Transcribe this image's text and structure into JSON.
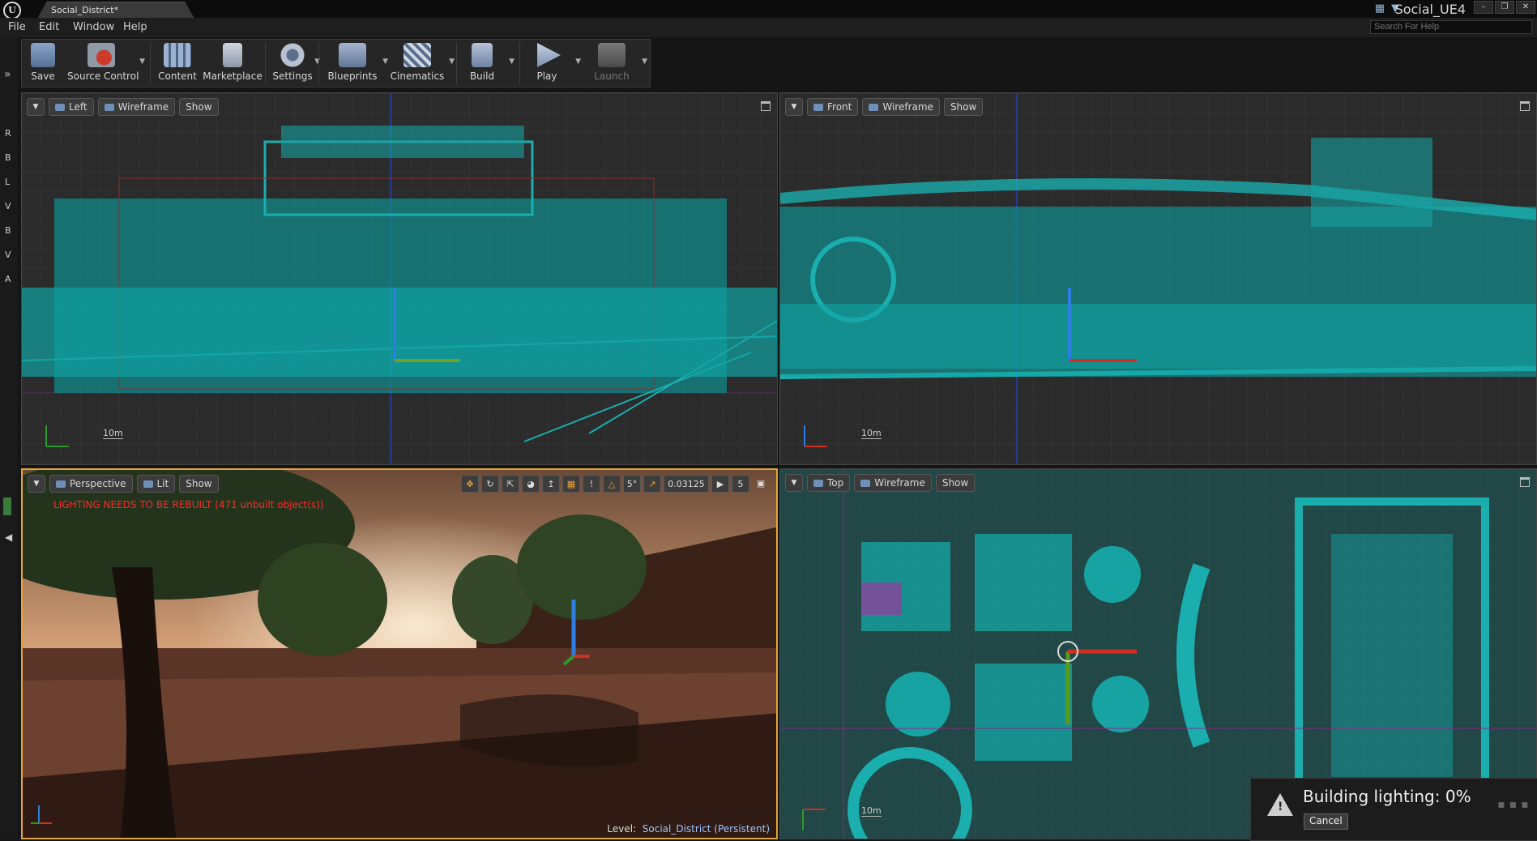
{
  "window": {
    "tab_title": "Social_District*",
    "project_name": "Social_UE4",
    "search_help_placeholder": "Search For Help"
  },
  "menu": {
    "items": [
      "File",
      "Edit",
      "Window",
      "Help"
    ]
  },
  "left_tabs": [
    "R",
    "B",
    "L",
    "V",
    "B",
    "V",
    "A"
  ],
  "toolbar": {
    "buttons": [
      {
        "label": "Save",
        "icon": "floppy-disk-icon"
      },
      {
        "label": "Source Control",
        "icon": "source-control-icon"
      },
      {
        "label": "Content",
        "icon": "content-browser-icon"
      },
      {
        "label": "Marketplace",
        "icon": "marketplace-icon"
      },
      {
        "label": "Settings",
        "icon": "gear-icon"
      },
      {
        "label": "Blueprints",
        "icon": "blueprint-icon"
      },
      {
        "label": "Cinematics",
        "icon": "clapperboard-icon"
      },
      {
        "label": "Build",
        "icon": "build-icon"
      },
      {
        "label": "Play",
        "icon": "play-icon"
      },
      {
        "label": "Launch",
        "icon": "launch-icon"
      }
    ]
  },
  "viewports": {
    "left": {
      "view": "Left",
      "mode": "Wireframe",
      "show": "Show",
      "scale": "10m"
    },
    "front": {
      "view": "Front",
      "mode": "Wireframe",
      "show": "Show",
      "scale": "10m"
    },
    "perspective": {
      "view": "Perspective",
      "mode": "Lit",
      "show": "Show",
      "warning": "LIGHTING NEEDS TO BE REBUILT (471 unbuilt object(s))",
      "level_label": "Level:",
      "level_name": "Social_District (Persistent)",
      "snap": {
        "rotation": "5°",
        "scale": "0.03125",
        "camera_speed": "5"
      }
    },
    "top": {
      "view": "Top",
      "mode": "Wireframe",
      "show": "Show",
      "scale": "10m"
    }
  },
  "notification": {
    "message": "Building lighting:  0%",
    "cancel_label": "Cancel"
  },
  "colors": {
    "wire": "#1a9e9e",
    "accent": "#e3a43c",
    "warning_text": "#ff2a2a"
  }
}
